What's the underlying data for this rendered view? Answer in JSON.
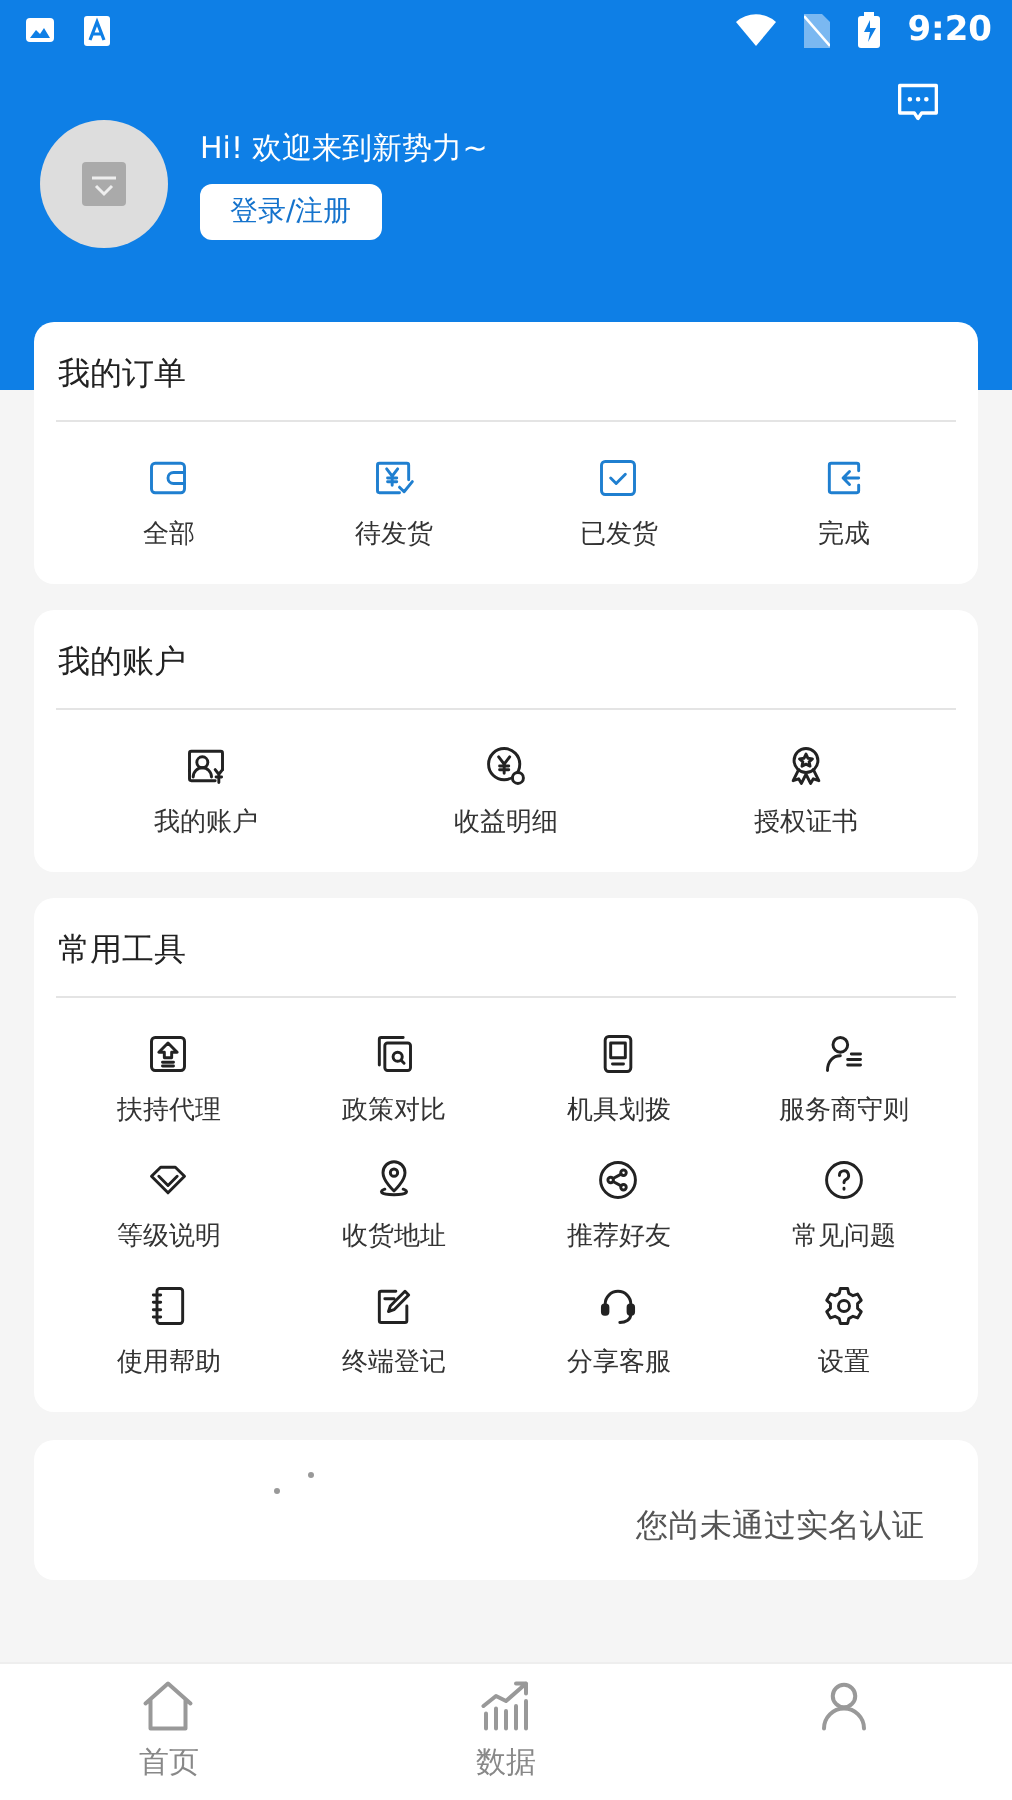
{
  "status_bar": {
    "time": "9:20"
  },
  "header": {
    "greeting": "Hi!  欢迎来到新势力~",
    "login_button": "登录/注册"
  },
  "sections": [
    {
      "title": "我的订单",
      "kind": "orders",
      "items": [
        "全部",
        "待发货",
        "已发货",
        "完成"
      ]
    },
    {
      "title": "我的账户",
      "kind": "account",
      "items": [
        "我的账户",
        "收益明细",
        "授权证书"
      ]
    },
    {
      "title": "常用工具",
      "kind": "tools",
      "items": [
        "扶持代理",
        "政策对比",
        "机具划拨",
        "服务商守则",
        "等级说明",
        "收货地址",
        "推荐好友",
        "常见问题",
        "使用帮助",
        "终端登记",
        "分享客服",
        "设置"
      ]
    }
  ],
  "notice": {
    "text": "您尚未通过实名认证"
  },
  "bottom_nav": [
    {
      "label": "首页",
      "selected": false
    },
    {
      "label": "数据",
      "selected": false
    }
  ]
}
